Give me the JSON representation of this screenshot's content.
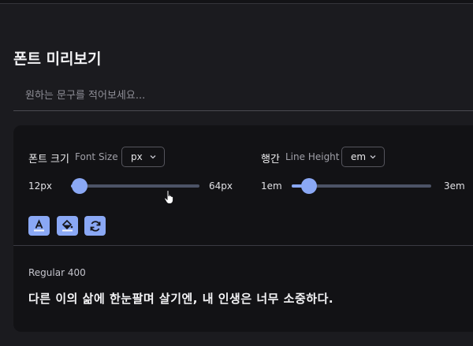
{
  "section": {
    "title": "폰트 미리보기"
  },
  "preview_input": {
    "value": "",
    "placeholder": "원하는 문구를 적어보세요..."
  },
  "font_size": {
    "label": "폰트 크기",
    "sublabel": "Font Size",
    "unit": "px",
    "min_label": "12px",
    "max_label": "64px",
    "min": 12,
    "max": 64,
    "value": 12
  },
  "line_height": {
    "label": "행간",
    "sublabel": "Line Height",
    "unit": "em",
    "min_label": "1em",
    "max_label": "3em",
    "min": 1,
    "max": 3,
    "value": 1.25
  },
  "toolbar": {
    "buttons": [
      {
        "icon": "text-color-icon"
      },
      {
        "icon": "fill-color-icon"
      },
      {
        "icon": "reset-icon"
      }
    ]
  },
  "preview": {
    "weight_label": "Regular 400",
    "text": "다른 이의 삶에 한눈팔며 살기엔, 내 인생은 너무 소중하다."
  },
  "colors": {
    "accent": "#8aa8f5",
    "background": "#1b1b1f",
    "card": "#121215"
  }
}
